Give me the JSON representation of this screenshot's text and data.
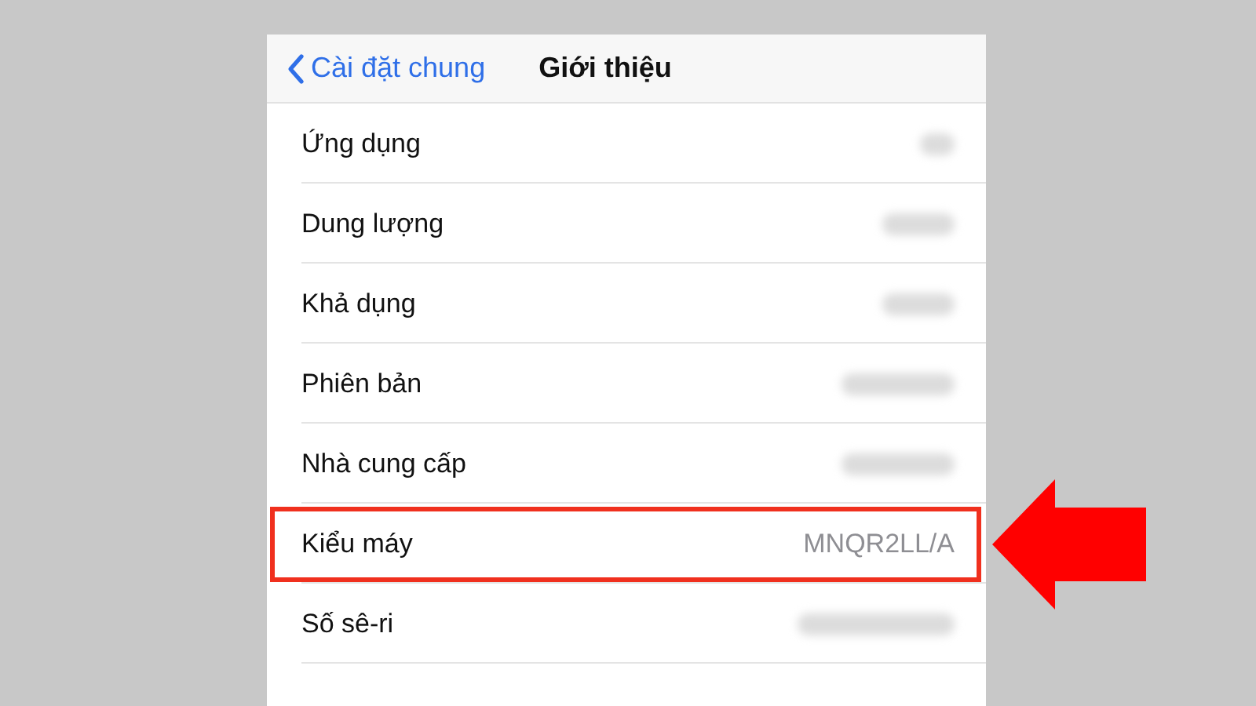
{
  "nav_bar": {
    "back_label": "Cài đặt chung",
    "title": "Giới thiệu"
  },
  "rows": [
    {
      "label": "Ứng dụng",
      "blurred": true,
      "highlighted": false
    },
    {
      "label": "Dung lượng",
      "blurred": true,
      "highlighted": false
    },
    {
      "label": "Khả dụng",
      "blurred": true,
      "highlighted": false
    },
    {
      "label": "Phiên bản",
      "blurred": true,
      "highlighted": false
    },
    {
      "label": "Nhà cung cấp",
      "blurred": true,
      "highlighted": false
    },
    {
      "label": "Kiểu máy",
      "value": "MNQR2LL/A",
      "blurred": false,
      "highlighted": true
    },
    {
      "label": "Số sê-ri",
      "blurred": true,
      "highlighted": false
    }
  ]
}
